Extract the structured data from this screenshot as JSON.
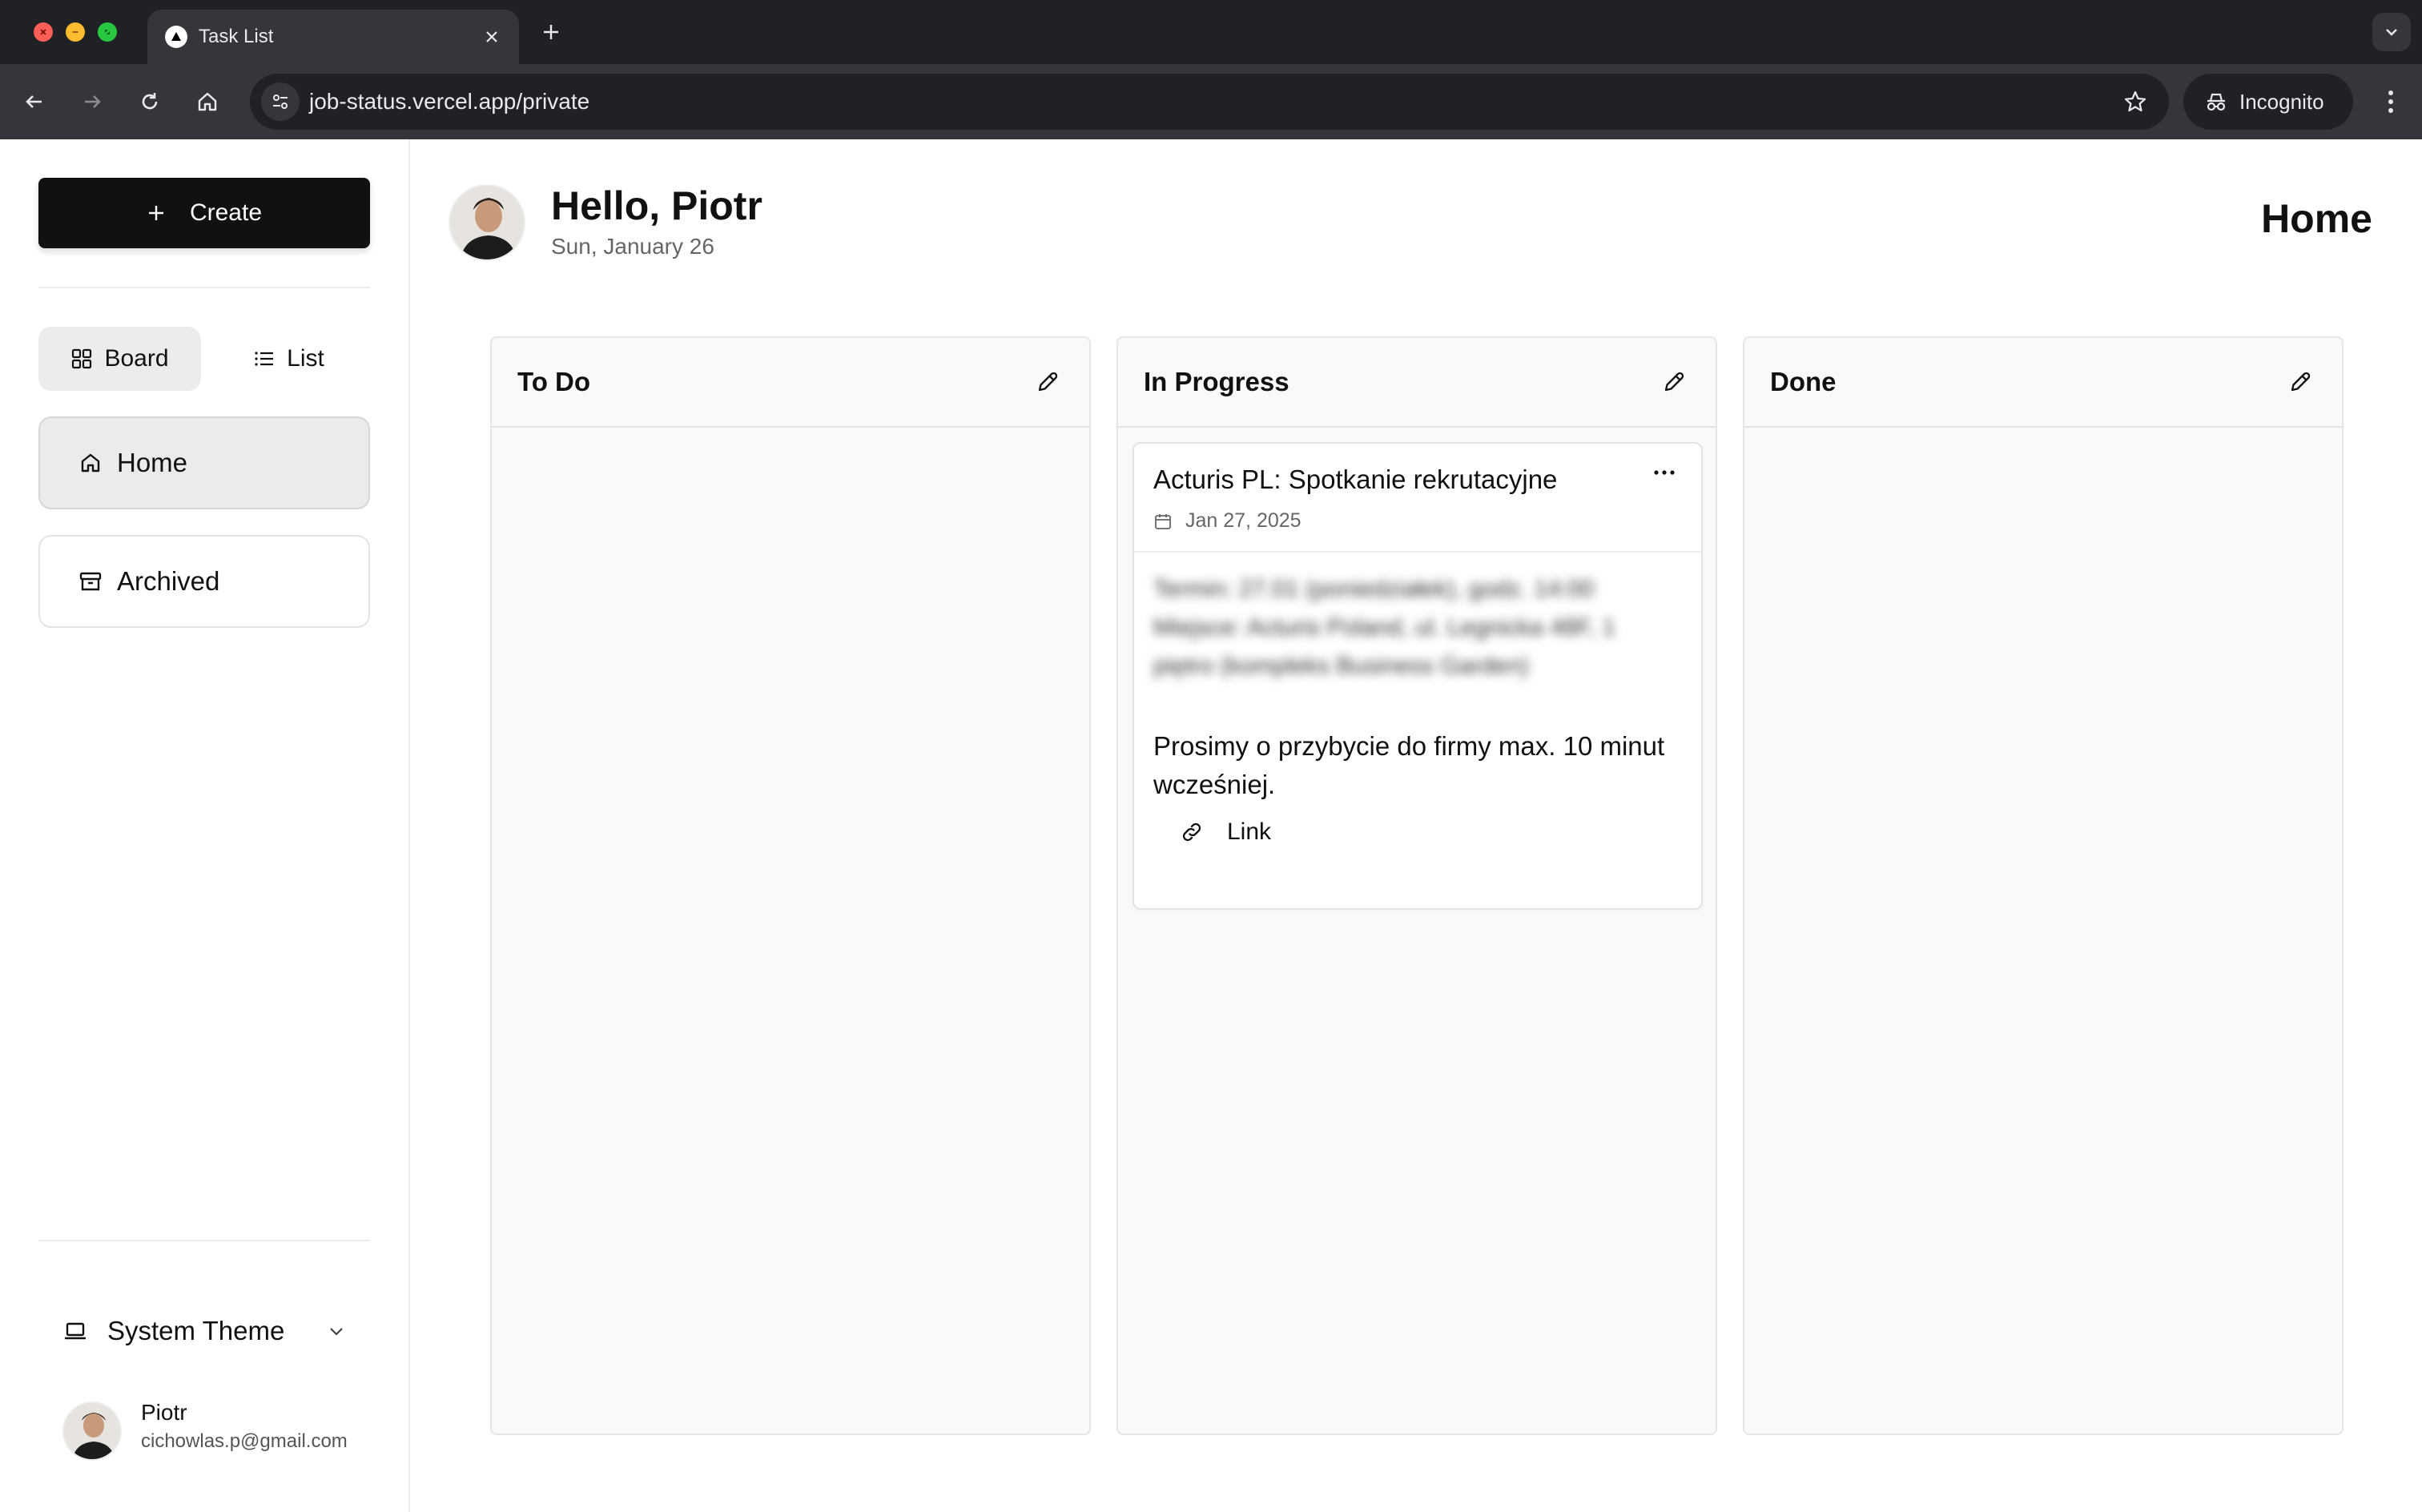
{
  "browser": {
    "tab_title": "Task List",
    "url": "job-status.vercel.app/private",
    "incognito_label": "Incognito"
  },
  "sidebar": {
    "create_label": "Create",
    "view_options": [
      {
        "label": "Board",
        "icon": "grid-icon",
        "active": true
      },
      {
        "label": "List",
        "icon": "list-icon",
        "active": false
      }
    ],
    "nav_items": [
      {
        "label": "Home",
        "icon": "home-icon",
        "active": true
      },
      {
        "label": "Archived",
        "icon": "archive-icon",
        "active": false
      }
    ],
    "theme_label": "System Theme",
    "user": {
      "name": "Piotr",
      "email": "cichowlas.p@gmail.com"
    }
  },
  "header": {
    "greeting": "Hello, Piotr",
    "date": "Sun, January 26",
    "page_title": "Home"
  },
  "board": {
    "columns": [
      {
        "title": "To Do",
        "cards": []
      },
      {
        "title": "In Progress",
        "cards": [
          {
            "title": "Acturis PL: Spotkanie rekrutacyjne",
            "date": "Jan 27, 2025",
            "blurred_text": "Termin: 27.01 (poniedziałek), godz. 14:00 Miejsce: Acturis Poland, ul. Legnicka 48F, 1 piętro (kompleks Business Garden)",
            "description": "Prosimy o przybycie do firmy max. 10 minut wcześniej.",
            "link_label": "Link"
          }
        ]
      },
      {
        "title": "Done",
        "cards": []
      }
    ]
  },
  "colors": {
    "primary_button": "#111111",
    "column_bg": "#f9f9f9",
    "active_nav_bg": "#ebebeb",
    "chrome_dark": "#202124",
    "chrome_toolbar": "#35363a"
  }
}
